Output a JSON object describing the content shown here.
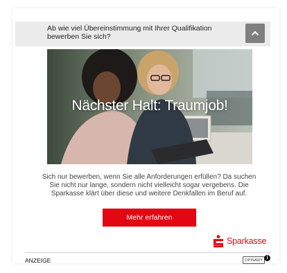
{
  "question": {
    "text": "Ab wie viel Übereinstimmung mit Ihrer Qualifikation bewerben Sie sich?",
    "collapse_icon": "chevron-up-icon"
  },
  "hero": {
    "title": "Nächster Halt: Traumjob!"
  },
  "teaser": {
    "text": "Sich nur bewerben, wenn Sie alle Anforderungen erfüllen? Da suchen Sie nicht nur lange, sondern nicht vielleicht sogar vergebens. Die Sparkasse klärt über diese und weitere Denkfallen im Beruf auf."
  },
  "cta": {
    "label": "Mehr erfahren",
    "color": "#e30613"
  },
  "brand": {
    "name": "Sparkasse",
    "color": "#e30613"
  },
  "footer": {
    "ad_label": "ANZEIGE",
    "provider": "OPINARY",
    "info_icon": "info-icon"
  }
}
